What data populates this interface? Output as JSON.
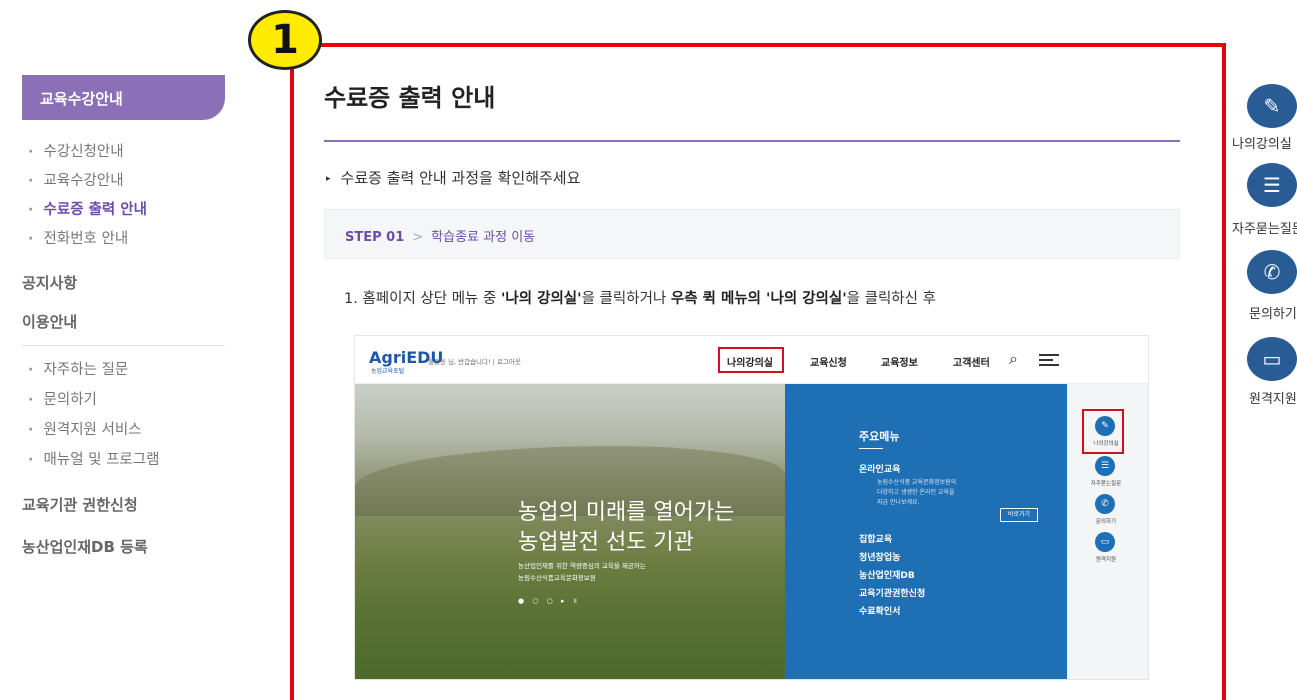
{
  "sidebar": {
    "header": "교육수강안내",
    "subitems": [
      "수강신청안내",
      "교육수강안내",
      "수료증 출력 안내",
      "전화번호 안내"
    ],
    "main_items": [
      "공지사항",
      "이용안내"
    ],
    "subitems2": [
      "자주하는 질문",
      "문의하기",
      "원격지원 서비스",
      "매뉴얼 및 프로그램"
    ],
    "bottom_items": [
      "교육기관 권한신청",
      "농산업인재DB 등록"
    ]
  },
  "badge": "1",
  "content": {
    "title": "수료증 출력 안내",
    "desc": "수료증 출력 안내 과정을 확인해주세요",
    "step_num": "STEP 01",
    "step_arrow": ">",
    "step_text": "학습종료 과정 이동",
    "instr_1": "1. 홈페이지 상단 메뉴 중 ",
    "instr_2": "'나의 강의실'",
    "instr_3": "을 클릭하거나 ",
    "instr_4": "우측 퀵 메뉴의 '나의 강의실'",
    "instr_5": "을 클릭하신 후"
  },
  "screenshot": {
    "logo": "AgriEDU",
    "logo_sub": "농업교육포털",
    "greeting": "홍길동 님, 반갑습니다!  |  로그아웃",
    "nav": [
      "나의강의실",
      "교육신청",
      "교육정보",
      "고객센터"
    ],
    "hero_t1": "농업의 미래를 열어가는",
    "hero_t2": "농업발전 선도 기관",
    "hero_s1": "농산업인재를 위한 역량중심의 교육을 제공하는",
    "hero_s2": "농림수산식품교육문화정보원",
    "hero_dots": "● ○ ○ ▸ ॥",
    "main_menu_title": "주요메뉴",
    "main_menu_items": [
      "온라인교육",
      "집합교육",
      "청년창업농",
      "농산업인재DB",
      "교육기관권한신청",
      "수료확인서"
    ],
    "online_desc_1": "농림수산식품 교육문화정보원의",
    "online_desc_2": "다양하고 생생한 온라인 교육을",
    "online_desc_3": "지금 만나보세요.",
    "button": "바로가기",
    "quick": [
      "나의강의실",
      "자주묻는질문",
      "문의하기",
      "원격지원"
    ]
  },
  "quickmenu": {
    "items": [
      "나의강의실",
      "자주묻는질문",
      "문의하기",
      "원격지원"
    ],
    "icons": [
      "pencil-icon",
      "chat-icon",
      "phone-icon",
      "monitor-icon"
    ]
  },
  "colors": {
    "accent_purple": "#8b70b8",
    "active_purple": "#6c4ea8",
    "frame_red": "#e50012",
    "badge_yellow": "#ffeb00",
    "quick_blue": "#295c95"
  }
}
